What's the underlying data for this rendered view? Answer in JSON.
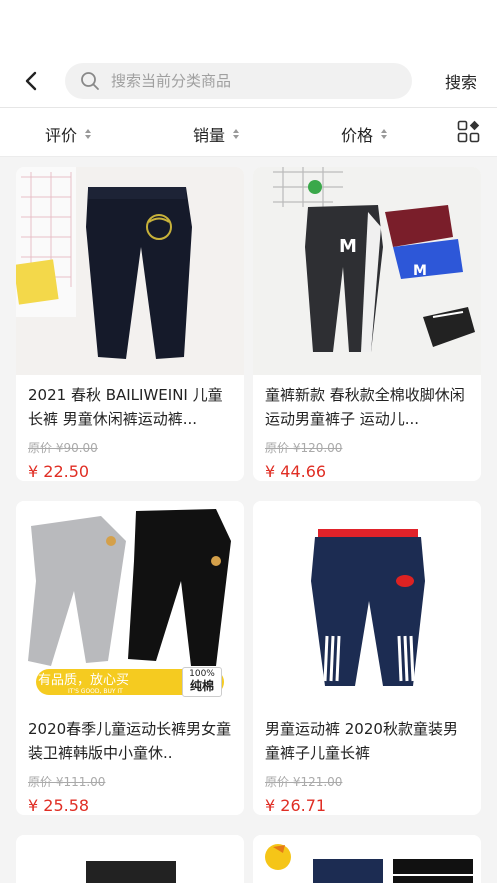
{
  "search": {
    "placeholder": "搜索当前分类商品",
    "button_label": "搜索"
  },
  "sort": {
    "rating_label": "评价",
    "sales_label": "销量",
    "price_label": "价格"
  },
  "products": [
    {
      "title": "2021 春秋 BAILIWEINI 儿童长裤 男童休闲裤运动裤...",
      "original_price": "原价 ¥90.00",
      "price": "¥ 22.50"
    },
    {
      "title": "童裤新款 春秋款全棉收脚休闲运动男童裤子 运动儿...",
      "original_price": "原价 ¥120.00",
      "price": "¥ 44.66"
    },
    {
      "title": "2020春季儿童运动长裤男女童装卫裤韩版中小童休..",
      "original_price": "原价 ¥111.00",
      "price": "¥ 25.58"
    },
    {
      "title": "男童运动裤 2020秋款童装男童裤子儿童长裤",
      "original_price": "原价 ¥121.00",
      "price": "¥ 26.71"
    }
  ],
  "banner": {
    "slogan": "有品质，放心买",
    "subslogan": "IT'S GOOD, BUY IT",
    "badge_top": "100%",
    "badge_bottom": "纯棉"
  },
  "colors": {
    "accent": "#e02e24",
    "background": "#f4f4f4"
  },
  "icons": [
    "back-arrow-icon",
    "search-icon",
    "sort-arrows-icon",
    "grid-layout-icon"
  ]
}
